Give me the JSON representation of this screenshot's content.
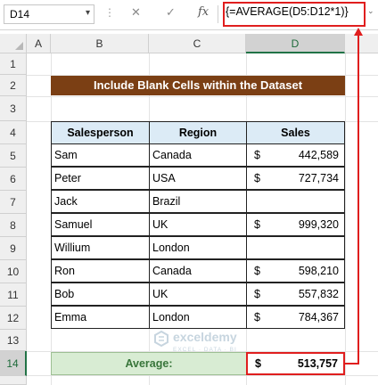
{
  "formula_bar": {
    "name_box": "D14",
    "cancel_icon": "✕",
    "confirm_icon": "✓",
    "fx_label": "fx",
    "formula": "{=AVERAGE(D5:D12*1)}"
  },
  "columns": [
    "A",
    "B",
    "C",
    "D"
  ],
  "selected_column": "D",
  "rows": [
    "1",
    "2",
    "3",
    "4",
    "5",
    "6",
    "7",
    "8",
    "9",
    "10",
    "11",
    "12",
    "13",
    "14"
  ],
  "selected_row": "14",
  "title": "Include Blank Cells within the Dataset",
  "table": {
    "headers": [
      "Salesperson",
      "Region",
      "Sales"
    ],
    "rows": [
      {
        "name": "Sam",
        "region": "Canada",
        "currency": "$",
        "sales": "442,589"
      },
      {
        "name": "Peter",
        "region": "USA",
        "currency": "$",
        "sales": "727,734"
      },
      {
        "name": "Jack",
        "region": "Brazil",
        "currency": "",
        "sales": ""
      },
      {
        "name": "Samuel",
        "region": "UK",
        "currency": "$",
        "sales": "999,320"
      },
      {
        "name": "Willium",
        "region": "London",
        "currency": "",
        "sales": ""
      },
      {
        "name": "Ron",
        "region": "Canada",
        "currency": "$",
        "sales": "598,210"
      },
      {
        "name": "Bob",
        "region": "UK",
        "currency": "$",
        "sales": "557,832"
      },
      {
        "name": "Emma",
        "region": "London",
        "currency": "$",
        "sales": "784,367"
      }
    ]
  },
  "average": {
    "label": "Average:",
    "currency": "$",
    "value": "513,757"
  },
  "watermark": {
    "title": "exceldemy",
    "subtitle": "EXCEL · DATA · BI"
  },
  "colors": {
    "title_bg": "#7b3f14",
    "header_bg": "#dcebf6",
    "average_bg": "#d8ecd3",
    "highlight": "#e01e1e",
    "selection": "#217346"
  }
}
